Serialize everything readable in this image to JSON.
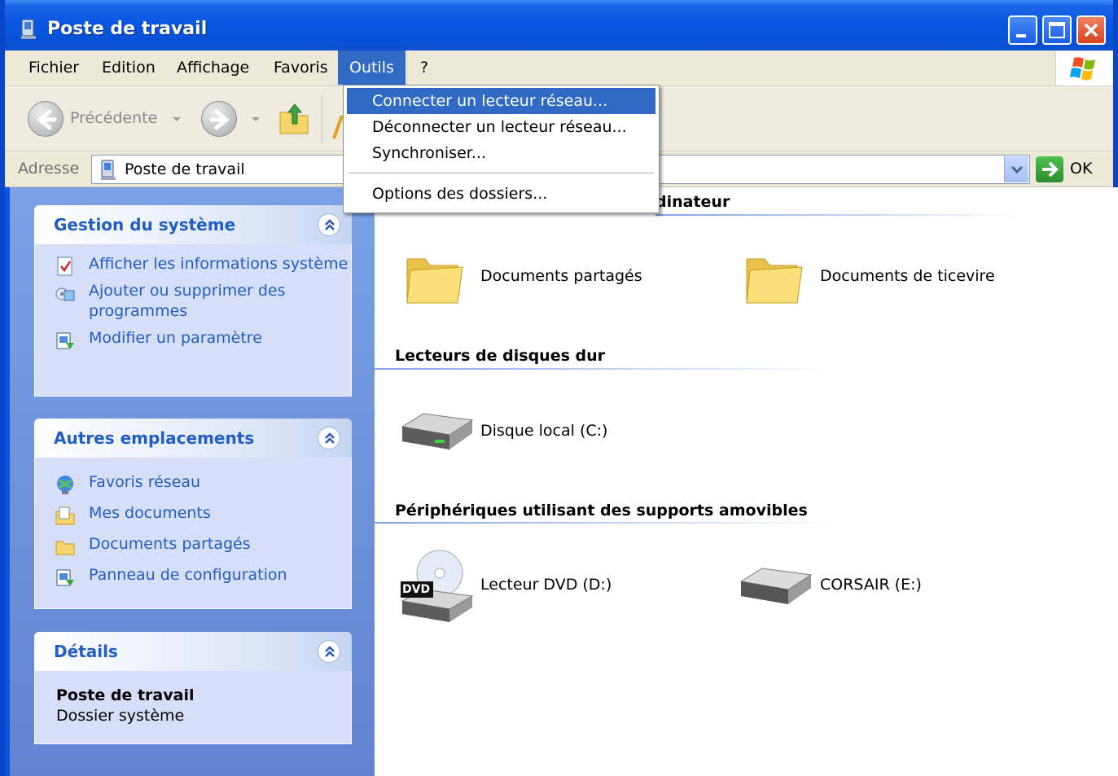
{
  "window": {
    "title": "Poste de travail",
    "accent": "#0a54e0"
  },
  "menubar": {
    "items": [
      "Fichier",
      "Edition",
      "Affichage",
      "Favoris",
      "Outils",
      "?"
    ],
    "active": "Outils"
  },
  "toolbar": {
    "back_label": "Précédente"
  },
  "address": {
    "label": "Adresse",
    "value": "Poste de travail",
    "go_label": "OK"
  },
  "tools_menu": {
    "items": [
      "Connecter un lecteur réseau...",
      "Déconnecter un lecteur réseau...",
      "Synchroniser...",
      "Options des dossiers..."
    ],
    "highlighted": "Connecter un lecteur réseau..."
  },
  "taskpane": {
    "system": {
      "title": "Gestion du système",
      "links": [
        {
          "label": "Afficher les informations système",
          "icon": "info-icon"
        },
        {
          "label": "Ajouter ou supprimer des programmes",
          "icon": "add-remove-icon"
        },
        {
          "label": "Modifier un paramètre",
          "icon": "control-panel-icon"
        }
      ]
    },
    "places": {
      "title": "Autres emplacements",
      "links": [
        {
          "label": "Favoris réseau",
          "icon": "network-icon"
        },
        {
          "label": "Mes documents",
          "icon": "documents-icon"
        },
        {
          "label": "Documents partagés",
          "icon": "folder-icon"
        },
        {
          "label": "Panneau de configuration",
          "icon": "control-panel-icon"
        }
      ]
    },
    "details": {
      "title": "Détails",
      "name": "Poste de travail",
      "type": "Dossier système"
    }
  },
  "content": {
    "group1_partial": "dinateur",
    "group1_items": [
      "Documents partagés",
      "Documents de ticevire"
    ],
    "group2": "Lecteurs de disques dur",
    "group2_items": [
      "Disque local (C:)"
    ],
    "group3": "Périphériques utilisant des supports amovibles",
    "group3_items": [
      "Lecteur DVD (D:)",
      "CORSAIR (E:)"
    ],
    "dvd_badge": "DVD"
  }
}
